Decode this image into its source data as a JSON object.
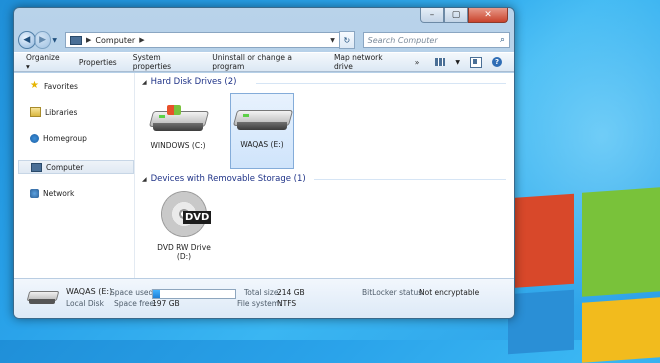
{
  "window": {
    "caption": {
      "minimize": "–",
      "maximize": "▢",
      "close": "✕"
    }
  },
  "nav": {
    "back": "◀",
    "forward": "▶",
    "breadcrumb": "Computer",
    "search_placeholder": "Search Computer"
  },
  "toolbar": {
    "items": [
      "Organize ▾",
      "Properties",
      "System properties",
      "Uninstall or change a program",
      "Map network drive",
      "»"
    ]
  },
  "sidebar": {
    "items": [
      {
        "label": "Favorites",
        "icon": "star-icon"
      },
      {
        "label": "Libraries",
        "icon": "library-icon"
      },
      {
        "label": "Homegroup",
        "icon": "homegroup-icon"
      },
      {
        "label": "Computer",
        "icon": "computer-icon",
        "selected": true
      },
      {
        "label": "Network",
        "icon": "network-icon"
      }
    ]
  },
  "groups": {
    "hdd": {
      "title": "Hard Disk Drives (2)",
      "drives": [
        {
          "label": "WINDOWS (C:)",
          "selected": false
        },
        {
          "label": "WAQAS (E:)",
          "selected": true
        }
      ]
    },
    "removable": {
      "title": "Devices with Removable Storage (1)",
      "devices": [
        {
          "label_line1": "DVD RW Drive",
          "label_line2": "(D:)",
          "badge": "DVD"
        }
      ]
    }
  },
  "details": {
    "name": "WAQAS (E:)",
    "type": "Local Disk",
    "space_used_label": "Space used:",
    "space_used_fraction": 0.08,
    "space_free_label": "Space free:",
    "space_free_value": "197 GB",
    "total_size_label": "Total size:",
    "total_size_value": "214 GB",
    "file_system_label": "File system:",
    "file_system_value": "NTFS",
    "bitlocker_label": "BitLocker status:",
    "bitlocker_value": "Not encryptable"
  },
  "colors": {
    "window_frame": "#a9c7e2",
    "accent": "#1f7fd6",
    "close": "#c9432c"
  }
}
